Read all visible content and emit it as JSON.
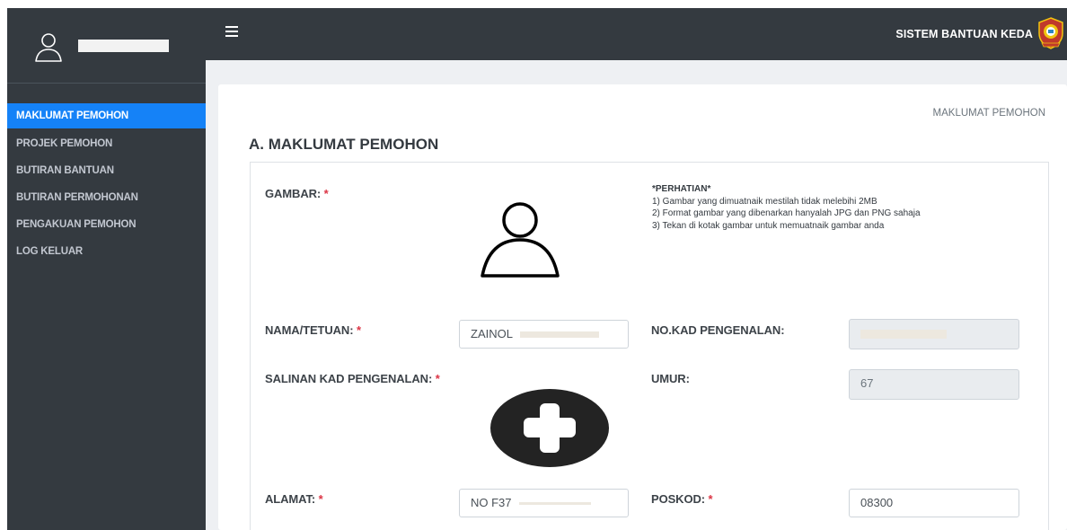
{
  "app": {
    "title": "SISTEM BANTUAN KEDA",
    "logo_icon": "keda-crest-icon"
  },
  "sidebar": {
    "user_icon": "user-outline-icon",
    "items": [
      {
        "label": "MAKLUMAT PEMOHON",
        "active": true
      },
      {
        "label": "PROJEK PEMOHON",
        "active": false
      },
      {
        "label": "BUTIRAN BANTUAN",
        "active": false
      },
      {
        "label": "BUTIRAN PERMOHONAN",
        "active": false
      },
      {
        "label": "PENGAKUAN PEMOHON",
        "active": false
      },
      {
        "label": "LOG KELUAR",
        "active": false
      }
    ]
  },
  "breadcrumb": "MAKLUMAT PEMOHON",
  "section_title": "A. MAKLUMAT PEMOHON",
  "form": {
    "gambar_label": "GAMBAR:",
    "required_mark": "*",
    "notice": {
      "title": "*PERHATIAN*",
      "lines": [
        "1) Gambar yang dimuatnaik mestilah tidak melebihi 2MB",
        "2) Format gambar yang dibenarkan hanyalah JPG dan PNG sahaja",
        "3) Tekan di kotak gambar untuk memuatnaik gambar anda"
      ]
    },
    "nama_label": "NAMA/TETUAN:",
    "nama_value": "ZAINOL",
    "ic_label": "NO.KAD PENGENALAN:",
    "salinan_label": "SALINAN KAD PENGENALAN:",
    "umur_label": "UMUR:",
    "umur_value": "67",
    "alamat_label": "ALAMAT:",
    "alamat_value": "NO F37",
    "poskod_label": "POSKOD:",
    "poskod_value": "08300"
  },
  "colors": {
    "sidebar_bg": "#343a40",
    "active_item": "#1582f7",
    "required": "#dc3545"
  }
}
